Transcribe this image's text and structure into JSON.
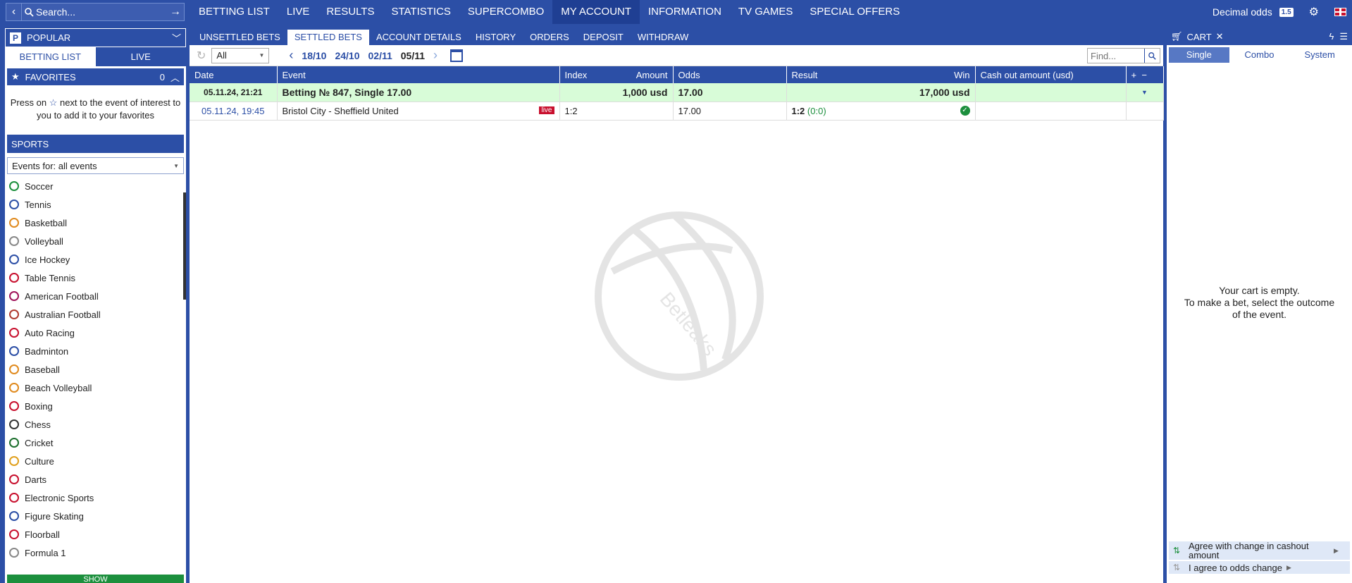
{
  "search": {
    "placeholder": "Search..."
  },
  "mainnav": [
    "BETTING LIST",
    "LIVE",
    "RESULTS",
    "STATISTICS",
    "SUPERCOMBO",
    "MY ACCOUNT",
    "INFORMATION",
    "TV GAMES",
    "SPECIAL OFFERS"
  ],
  "mainnav_active": "MY ACCOUNT",
  "topright": {
    "odds_label": "Decimal odds",
    "odds_badge": "1.5"
  },
  "left": {
    "popular": "POPULAR",
    "tabs": [
      "BETTING LIST",
      "LIVE"
    ],
    "favorites": {
      "title": "FAVORITES",
      "count": "0",
      "text_before": "Press on",
      "text_after": "next to the event of interest to you to add it to your favorites"
    },
    "sports_title": "SPORTS",
    "events_select": "Events for: all events",
    "sports": [
      {
        "name": "Soccer",
        "color": "#1c8f3d"
      },
      {
        "name": "Tennis",
        "color": "#2c4fa6"
      },
      {
        "name": "Basketball",
        "color": "#e08a1e"
      },
      {
        "name": "Volleyball",
        "color": "#888888"
      },
      {
        "name": "Ice Hockey",
        "color": "#2c4fa6"
      },
      {
        "name": "Table Tennis",
        "color": "#c8102e"
      },
      {
        "name": "American Football",
        "color": "#a0145a"
      },
      {
        "name": "Australian Football",
        "color": "#b03a2e"
      },
      {
        "name": "Auto Racing",
        "color": "#c8102e"
      },
      {
        "name": "Badminton",
        "color": "#2c4fa6"
      },
      {
        "name": "Baseball",
        "color": "#e08a1e"
      },
      {
        "name": "Beach Volleyball",
        "color": "#e08a1e"
      },
      {
        "name": "Boxing",
        "color": "#c8102e"
      },
      {
        "name": "Chess",
        "color": "#333333"
      },
      {
        "name": "Cricket",
        "color": "#1c6f2d"
      },
      {
        "name": "Culture",
        "color": "#e0a01e"
      },
      {
        "name": "Darts",
        "color": "#c8102e"
      },
      {
        "name": "Electronic Sports",
        "color": "#c8102e"
      },
      {
        "name": "Figure Skating",
        "color": "#2c4fa6"
      },
      {
        "name": "Floorball",
        "color": "#c8102e"
      },
      {
        "name": "Formula 1",
        "color": "#888888"
      }
    ],
    "show_button": "SHOW"
  },
  "subnav": [
    "UNSETTLED BETS",
    "SETTLED BETS",
    "ACCOUNT DETAILS",
    "HISTORY",
    "ORDERS",
    "DEPOSIT",
    "WITHDRAW"
  ],
  "subnav_active": "SETTLED BETS",
  "toolbar": {
    "filter": "All",
    "dates": [
      "18/10",
      "24/10",
      "02/11",
      "05/11"
    ],
    "current_date": "05/11",
    "find_placeholder": "Find..."
  },
  "table": {
    "headers": {
      "date": "Date",
      "event": "Event",
      "index": "Index",
      "amount": "Amount",
      "odds": "Odds",
      "result": "Result",
      "win": "Win",
      "cashout": "Cash out amount (usd)"
    },
    "summary": {
      "date": "05.11.24, 21:21",
      "event": "Betting № 847, Single 17.00",
      "amount": "1,000 usd",
      "odds": "17.00",
      "win": "17,000 usd"
    },
    "row": {
      "date": "05.11.24, 19:45",
      "event": "Bristol City - Sheffield United",
      "live": "live",
      "index": "1:2",
      "odds": "17.00",
      "result_main": "1:2",
      "result_sub": "(0:0)"
    }
  },
  "watermark": "Betleaks",
  "cart": {
    "title": "CART",
    "tabs": [
      "Single",
      "Combo",
      "System"
    ],
    "empty_line1": "Your cart is empty.",
    "empty_line2": "To make a bet, select the outcome of the event.",
    "option1": "Agree with change in cashout amount",
    "option2": "I agree to odds change"
  }
}
